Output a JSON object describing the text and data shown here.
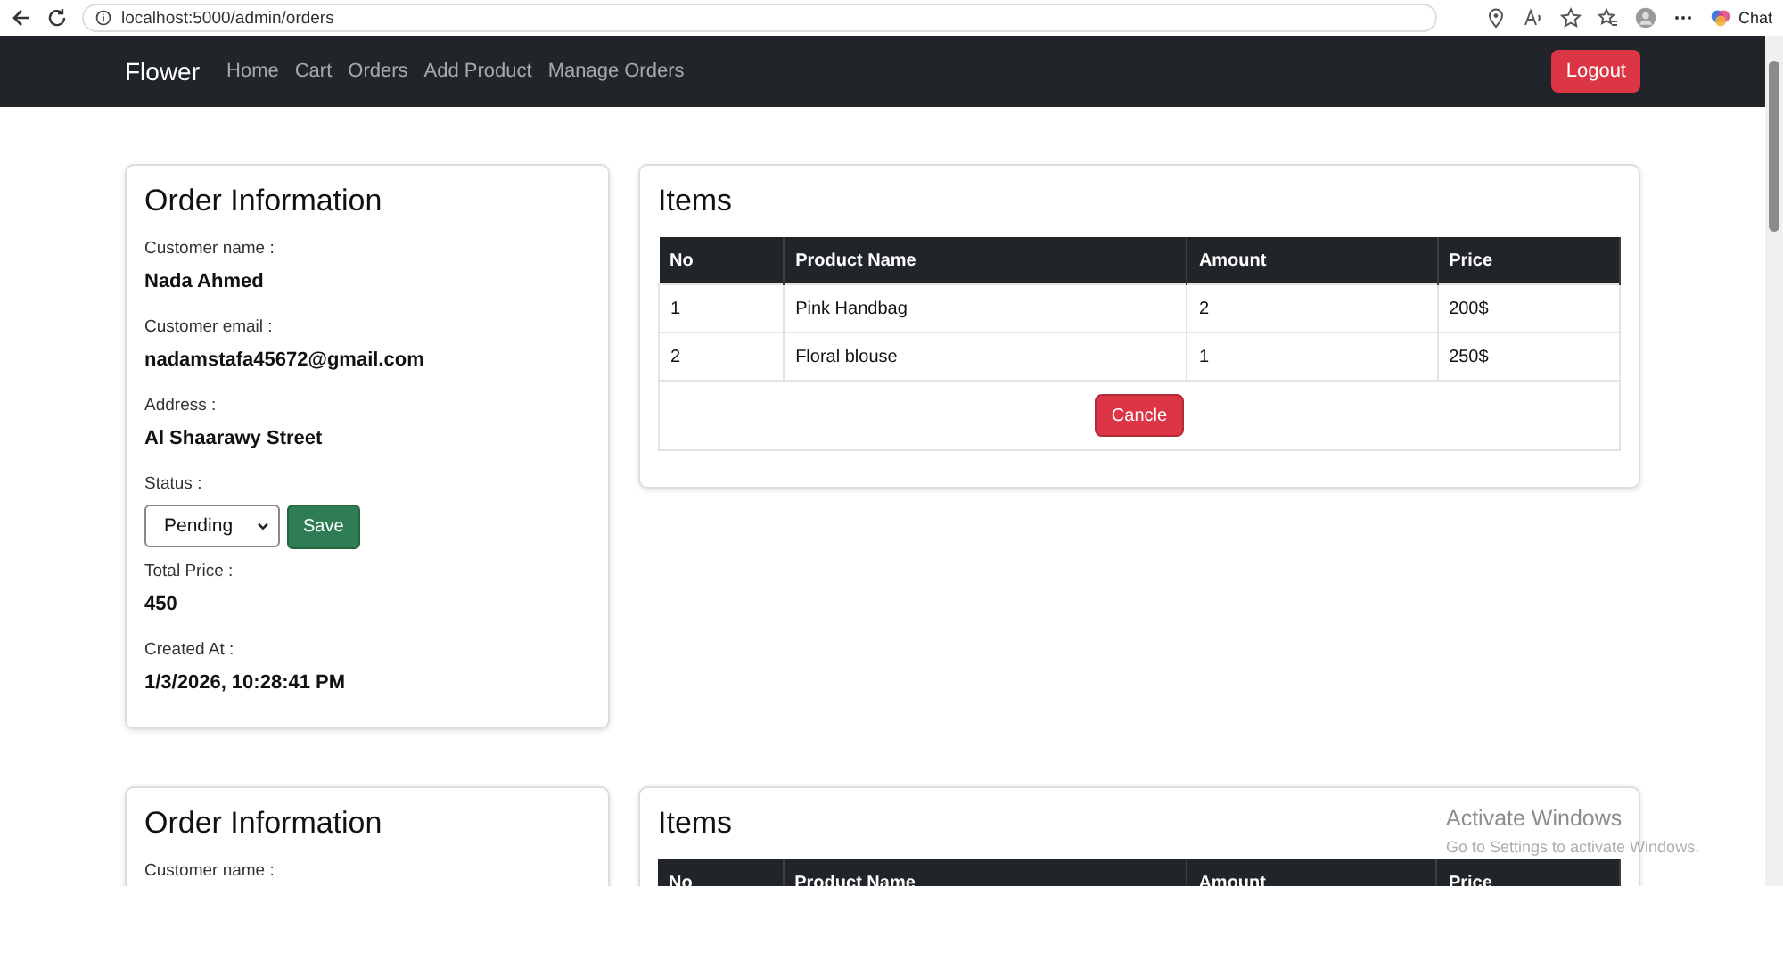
{
  "browser": {
    "url": "localhost:5000/admin/orders",
    "chat": "Chat"
  },
  "navbar": {
    "brand": "Flower",
    "links": [
      "Home",
      "Cart",
      "Orders",
      "Add Product",
      "Manage Orders"
    ],
    "logout": "Logout"
  },
  "orders": [
    {
      "title": "Order Information",
      "fields": [
        {
          "kind": "text",
          "label": "Customer name :",
          "value": "Nada Ahmed"
        },
        {
          "kind": "text",
          "label": "Customer email :",
          "value": "nadamstafa45672@gmail.com"
        },
        {
          "kind": "text",
          "label": "Address :",
          "value": "Al Shaarawy Street"
        },
        {
          "kind": "status",
          "label": "Status :",
          "value": "Pending",
          "button": "Save"
        },
        {
          "kind": "text",
          "label": "Total Price :",
          "value": "450"
        },
        {
          "kind": "text",
          "label": "Created At :",
          "value": "1/3/2026, 10:28:41 PM"
        }
      ],
      "items": {
        "title": "Items",
        "columns": [
          "No",
          "Product Name",
          "Amount",
          "Price"
        ],
        "rows": [
          [
            "1",
            "Pink Handbag",
            "2",
            "200$"
          ],
          [
            "2",
            "Floral blouse",
            "1",
            "250$"
          ]
        ],
        "cancel": "Cancle"
      }
    },
    {
      "title": "Order Information",
      "fields": [
        {
          "kind": "text",
          "label": "Customer name :"
        }
      ],
      "items": {
        "title": "Items",
        "columns": [
          "No",
          "Product Name",
          "Amount",
          "Price"
        ]
      }
    }
  ],
  "os_notice": {
    "title": "Activate Windows",
    "text": "Go to Settings to activate Windows."
  }
}
